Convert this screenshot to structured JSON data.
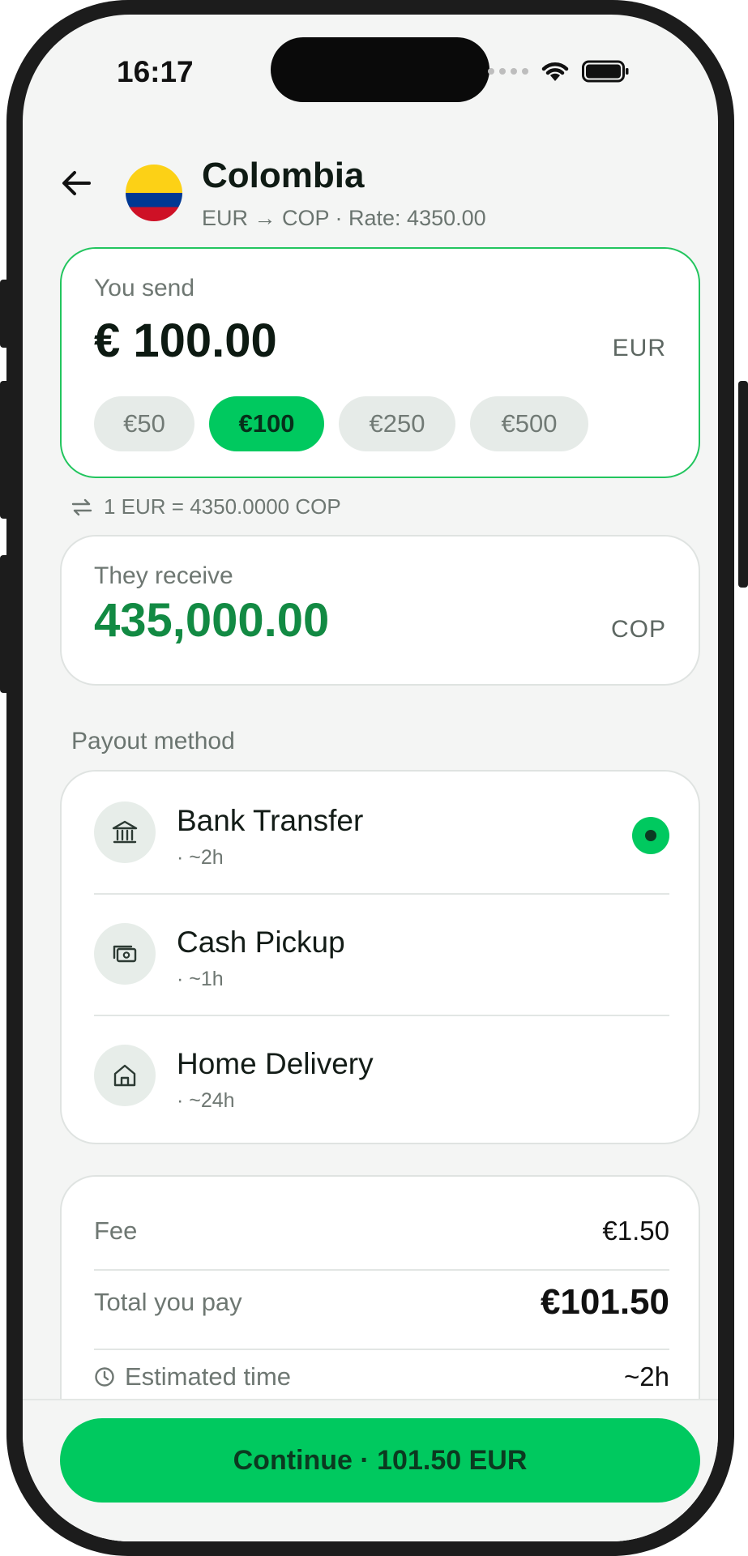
{
  "status_bar": {
    "time": "16:17"
  },
  "header": {
    "country": "Colombia",
    "route": "EUR → COP · Rate: 4350.00"
  },
  "send": {
    "label": "You send",
    "amount": "€ 100.00",
    "currency": "EUR",
    "chips": [
      "€50",
      "€100",
      "€250",
      "€500"
    ],
    "selected_chip": "€100"
  },
  "rate_line": "1 EUR = 4350.0000 COP",
  "receive": {
    "label": "They receive",
    "amount": "435,000.00",
    "currency": "COP"
  },
  "payout": {
    "title": "Payout method",
    "methods": [
      {
        "name": "Bank Transfer",
        "time": "· ~2h",
        "icon": "bank-icon",
        "selected": true
      },
      {
        "name": "Cash Pickup",
        "time": "· ~1h",
        "icon": "cash-icon",
        "selected": false
      },
      {
        "name": "Home Delivery",
        "time": "· ~24h",
        "icon": "home-icon",
        "selected": false
      }
    ]
  },
  "summary": {
    "fee_label": "Fee",
    "fee_value": "€1.50",
    "total_label": "Total you pay",
    "total_value": "€101.50",
    "eta_label": "Estimated time",
    "eta_value": "~2h"
  },
  "cta": {
    "label": "Continue · 101.50 EUR"
  },
  "colors": {
    "accent": "#00c95f",
    "receive_amount": "#128a43",
    "background": "#f4f5f4"
  }
}
